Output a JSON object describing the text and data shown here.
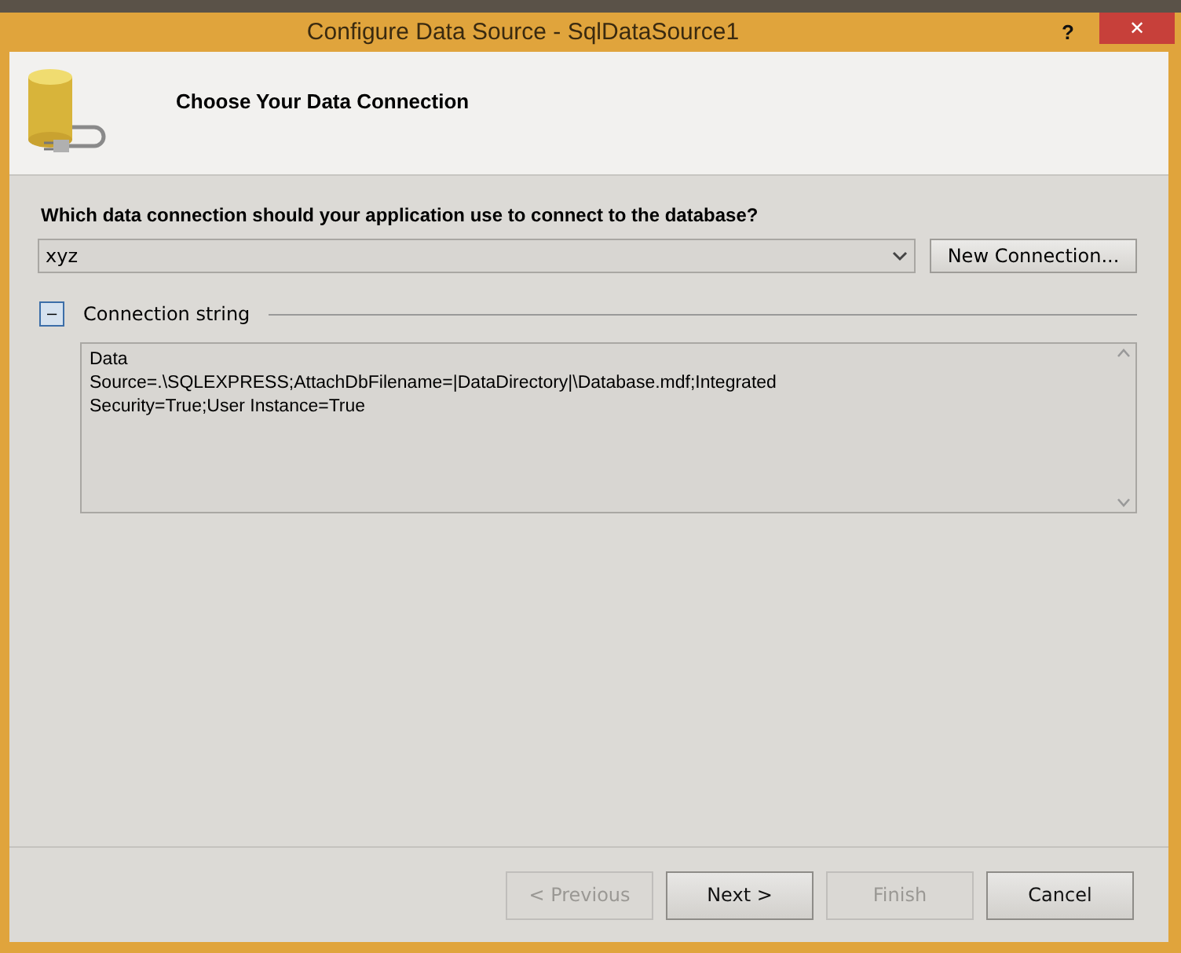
{
  "window": {
    "title": "Configure Data Source - SqlDataSource1",
    "help": "?",
    "close": "✕"
  },
  "header": {
    "title": "Choose Your Data Connection"
  },
  "question": "Which data connection should your application use to connect to the database?",
  "connection": {
    "value": "xyz"
  },
  "new_connection_button": "New Connection...",
  "connection_string": {
    "label": "Connection string",
    "expanded": true,
    "toggle": "–",
    "value": "Data Source=.\\SQLEXPRESS;AttachDbFilename=|DataDirectory|\\Database.mdf;Integrated Security=True;User Instance=True"
  },
  "buttons": [
    {
      "label": "< Previous",
      "disabled": true
    },
    {
      "label": "Next >",
      "disabled": false
    },
    {
      "label": "Finish",
      "disabled": true
    },
    {
      "label": "Cancel",
      "disabled": false
    }
  ]
}
